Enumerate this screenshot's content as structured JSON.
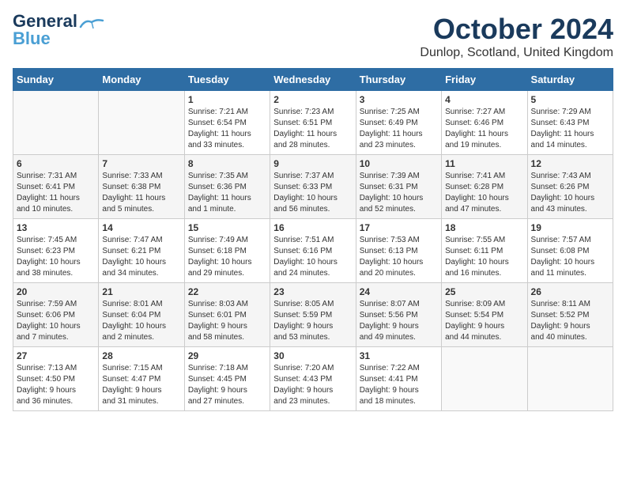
{
  "logo": {
    "line1": "General",
    "line2": "Blue"
  },
  "title": "October 2024",
  "location": "Dunlop, Scotland, United Kingdom",
  "weekdays": [
    "Sunday",
    "Monday",
    "Tuesday",
    "Wednesday",
    "Thursday",
    "Friday",
    "Saturday"
  ],
  "weeks": [
    [
      {
        "day": "",
        "details": ""
      },
      {
        "day": "",
        "details": ""
      },
      {
        "day": "1",
        "details": "Sunrise: 7:21 AM\nSunset: 6:54 PM\nDaylight: 11 hours\nand 33 minutes."
      },
      {
        "day": "2",
        "details": "Sunrise: 7:23 AM\nSunset: 6:51 PM\nDaylight: 11 hours\nand 28 minutes."
      },
      {
        "day": "3",
        "details": "Sunrise: 7:25 AM\nSunset: 6:49 PM\nDaylight: 11 hours\nand 23 minutes."
      },
      {
        "day": "4",
        "details": "Sunrise: 7:27 AM\nSunset: 6:46 PM\nDaylight: 11 hours\nand 19 minutes."
      },
      {
        "day": "5",
        "details": "Sunrise: 7:29 AM\nSunset: 6:43 PM\nDaylight: 11 hours\nand 14 minutes."
      }
    ],
    [
      {
        "day": "6",
        "details": "Sunrise: 7:31 AM\nSunset: 6:41 PM\nDaylight: 11 hours\nand 10 minutes."
      },
      {
        "day": "7",
        "details": "Sunrise: 7:33 AM\nSunset: 6:38 PM\nDaylight: 11 hours\nand 5 minutes."
      },
      {
        "day": "8",
        "details": "Sunrise: 7:35 AM\nSunset: 6:36 PM\nDaylight: 11 hours\nand 1 minute."
      },
      {
        "day": "9",
        "details": "Sunrise: 7:37 AM\nSunset: 6:33 PM\nDaylight: 10 hours\nand 56 minutes."
      },
      {
        "day": "10",
        "details": "Sunrise: 7:39 AM\nSunset: 6:31 PM\nDaylight: 10 hours\nand 52 minutes."
      },
      {
        "day": "11",
        "details": "Sunrise: 7:41 AM\nSunset: 6:28 PM\nDaylight: 10 hours\nand 47 minutes."
      },
      {
        "day": "12",
        "details": "Sunrise: 7:43 AM\nSunset: 6:26 PM\nDaylight: 10 hours\nand 43 minutes."
      }
    ],
    [
      {
        "day": "13",
        "details": "Sunrise: 7:45 AM\nSunset: 6:23 PM\nDaylight: 10 hours\nand 38 minutes."
      },
      {
        "day": "14",
        "details": "Sunrise: 7:47 AM\nSunset: 6:21 PM\nDaylight: 10 hours\nand 34 minutes."
      },
      {
        "day": "15",
        "details": "Sunrise: 7:49 AM\nSunset: 6:18 PM\nDaylight: 10 hours\nand 29 minutes."
      },
      {
        "day": "16",
        "details": "Sunrise: 7:51 AM\nSunset: 6:16 PM\nDaylight: 10 hours\nand 24 minutes."
      },
      {
        "day": "17",
        "details": "Sunrise: 7:53 AM\nSunset: 6:13 PM\nDaylight: 10 hours\nand 20 minutes."
      },
      {
        "day": "18",
        "details": "Sunrise: 7:55 AM\nSunset: 6:11 PM\nDaylight: 10 hours\nand 16 minutes."
      },
      {
        "day": "19",
        "details": "Sunrise: 7:57 AM\nSunset: 6:08 PM\nDaylight: 10 hours\nand 11 minutes."
      }
    ],
    [
      {
        "day": "20",
        "details": "Sunrise: 7:59 AM\nSunset: 6:06 PM\nDaylight: 10 hours\nand 7 minutes."
      },
      {
        "day": "21",
        "details": "Sunrise: 8:01 AM\nSunset: 6:04 PM\nDaylight: 10 hours\nand 2 minutes."
      },
      {
        "day": "22",
        "details": "Sunrise: 8:03 AM\nSunset: 6:01 PM\nDaylight: 9 hours\nand 58 minutes."
      },
      {
        "day": "23",
        "details": "Sunrise: 8:05 AM\nSunset: 5:59 PM\nDaylight: 9 hours\nand 53 minutes."
      },
      {
        "day": "24",
        "details": "Sunrise: 8:07 AM\nSunset: 5:56 PM\nDaylight: 9 hours\nand 49 minutes."
      },
      {
        "day": "25",
        "details": "Sunrise: 8:09 AM\nSunset: 5:54 PM\nDaylight: 9 hours\nand 44 minutes."
      },
      {
        "day": "26",
        "details": "Sunrise: 8:11 AM\nSunset: 5:52 PM\nDaylight: 9 hours\nand 40 minutes."
      }
    ],
    [
      {
        "day": "27",
        "details": "Sunrise: 7:13 AM\nSunset: 4:50 PM\nDaylight: 9 hours\nand 36 minutes."
      },
      {
        "day": "28",
        "details": "Sunrise: 7:15 AM\nSunset: 4:47 PM\nDaylight: 9 hours\nand 31 minutes."
      },
      {
        "day": "29",
        "details": "Sunrise: 7:18 AM\nSunset: 4:45 PM\nDaylight: 9 hours\nand 27 minutes."
      },
      {
        "day": "30",
        "details": "Sunrise: 7:20 AM\nSunset: 4:43 PM\nDaylight: 9 hours\nand 23 minutes."
      },
      {
        "day": "31",
        "details": "Sunrise: 7:22 AM\nSunset: 4:41 PM\nDaylight: 9 hours\nand 18 minutes."
      },
      {
        "day": "",
        "details": ""
      },
      {
        "day": "",
        "details": ""
      }
    ]
  ]
}
